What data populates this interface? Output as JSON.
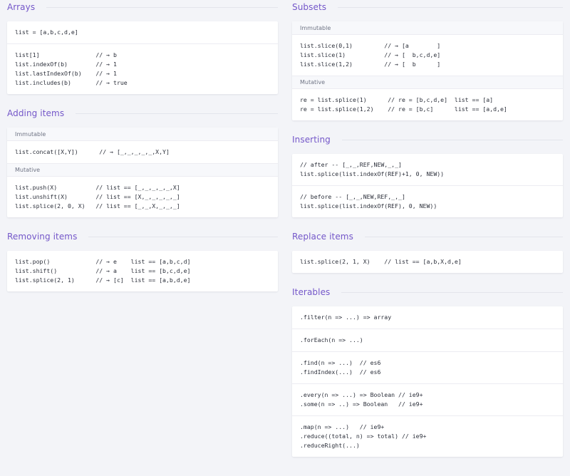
{
  "left": [
    {
      "title": "Arrays",
      "blocks": [
        {
          "type": "code",
          "lines": [
            "list = [a,b,c,d,e]"
          ]
        },
        {
          "type": "code",
          "lines": [
            "list[1]                // → b",
            "list.indexOf(b)        // → 1",
            "list.lastIndexOf(b)    // → 1",
            "list.includes(b)       // → true"
          ]
        }
      ]
    },
    {
      "title": "Adding items",
      "blocks": [
        {
          "type": "sub",
          "label": "Immutable"
        },
        {
          "type": "code",
          "lines": [
            "list.concat([X,Y])      // → [_,_,_,_,_,X,Y]"
          ]
        },
        {
          "type": "sub",
          "label": "Mutative"
        },
        {
          "type": "code",
          "lines": [
            "list.push(X)           // list == [_,_,_,_,_,X]",
            "list.unshift(X)        // list == [X,_,_,_,_,_]",
            "list.splice(2, 0, X)   // list == [_,_,X,_,_,_]"
          ]
        }
      ]
    },
    {
      "title": "Removing items",
      "blocks": [
        {
          "type": "code",
          "lines": [
            "list.pop()             // → e    list == [a,b,c,d]",
            "list.shift()           // → a    list == [b,c,d,e]",
            "list.splice(2, 1)      // → [c]  list == [a,b,d,e]"
          ]
        }
      ]
    }
  ],
  "right": [
    {
      "title": "Subsets",
      "blocks": [
        {
          "type": "sub",
          "label": "Immutable"
        },
        {
          "type": "code",
          "lines": [
            "list.slice(0,1)         // → [a        ]",
            "list.slice(1)           // → [  b,c,d,e]",
            "list.slice(1,2)         // → [  b      ]"
          ]
        },
        {
          "type": "sub",
          "label": "Mutative"
        },
        {
          "type": "code",
          "lines": [
            "re = list.splice(1)      // re = [b,c,d,e]  list == [a]",
            "re = list.splice(1,2)    // re = [b,c]      list == [a,d,e]"
          ]
        }
      ]
    },
    {
      "title": "Inserting",
      "blocks": [
        {
          "type": "code",
          "lines": [
            "// after -- [_,_,REF,NEW,_,_]",
            "list.splice(list.indexOf(REF)+1, 0, NEW))"
          ]
        },
        {
          "type": "code",
          "lines": [
            "// before -- [_,_,NEW,REF,_,_]",
            "list.splice(list.indexOf(REF), 0, NEW))"
          ]
        }
      ]
    },
    {
      "title": "Replace items",
      "blocks": [
        {
          "type": "code",
          "lines": [
            "list.splice(2, 1, X)    // list == [a,b,X,d,e]"
          ]
        }
      ]
    },
    {
      "title": "Iterables",
      "blocks": [
        {
          "type": "code",
          "lines": [
            ".filter(n => ...) => array"
          ]
        },
        {
          "type": "code",
          "lines": [
            ".forEach(n => ...)"
          ]
        },
        {
          "type": "code",
          "lines": [
            ".find(n => ...)  // es6",
            ".findIndex(...)  // es6"
          ]
        },
        {
          "type": "code",
          "lines": [
            ".every(n => ...) => Boolean // ie9+",
            ".some(n => ..) => Boolean   // ie9+"
          ]
        },
        {
          "type": "code",
          "lines": [
            ".map(n => ...)   // ie9+",
            ".reduce((total, n) => total) // ie9+",
            ".reduceRight(...)"
          ]
        }
      ]
    }
  ]
}
